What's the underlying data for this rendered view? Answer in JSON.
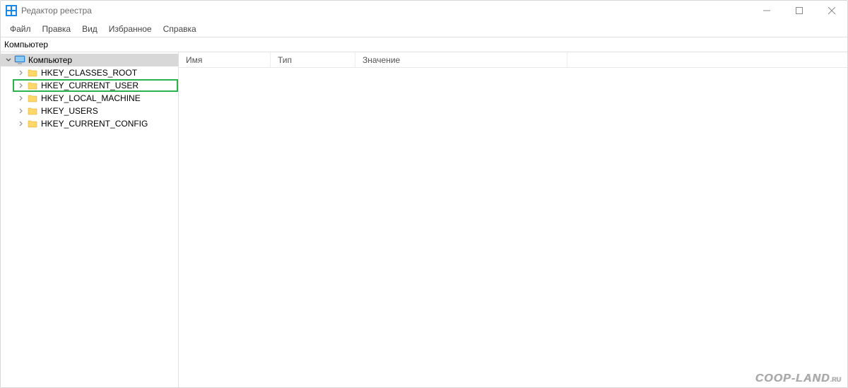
{
  "window": {
    "title": "Редактор реестра"
  },
  "menu": {
    "file": "Файл",
    "edit": "Правка",
    "view": "Вид",
    "favorites": "Избранное",
    "help": "Справка"
  },
  "address": {
    "path": "Компьютер"
  },
  "tree": {
    "root": {
      "label": "Компьютер",
      "expanded": true,
      "selected": true,
      "children": [
        {
          "label": "HKEY_CLASSES_ROOT",
          "highlighted": false
        },
        {
          "label": "HKEY_CURRENT_USER",
          "highlighted": true
        },
        {
          "label": "HKEY_LOCAL_MACHINE",
          "highlighted": false
        },
        {
          "label": "HKEY_USERS",
          "highlighted": false
        },
        {
          "label": "HKEY_CURRENT_CONFIG",
          "highlighted": false
        }
      ]
    }
  },
  "columns": {
    "name": "Имя",
    "type": "Тип",
    "value": "Значение"
  },
  "watermark": "COOP-LAND",
  "watermark_suffix": ".RU"
}
